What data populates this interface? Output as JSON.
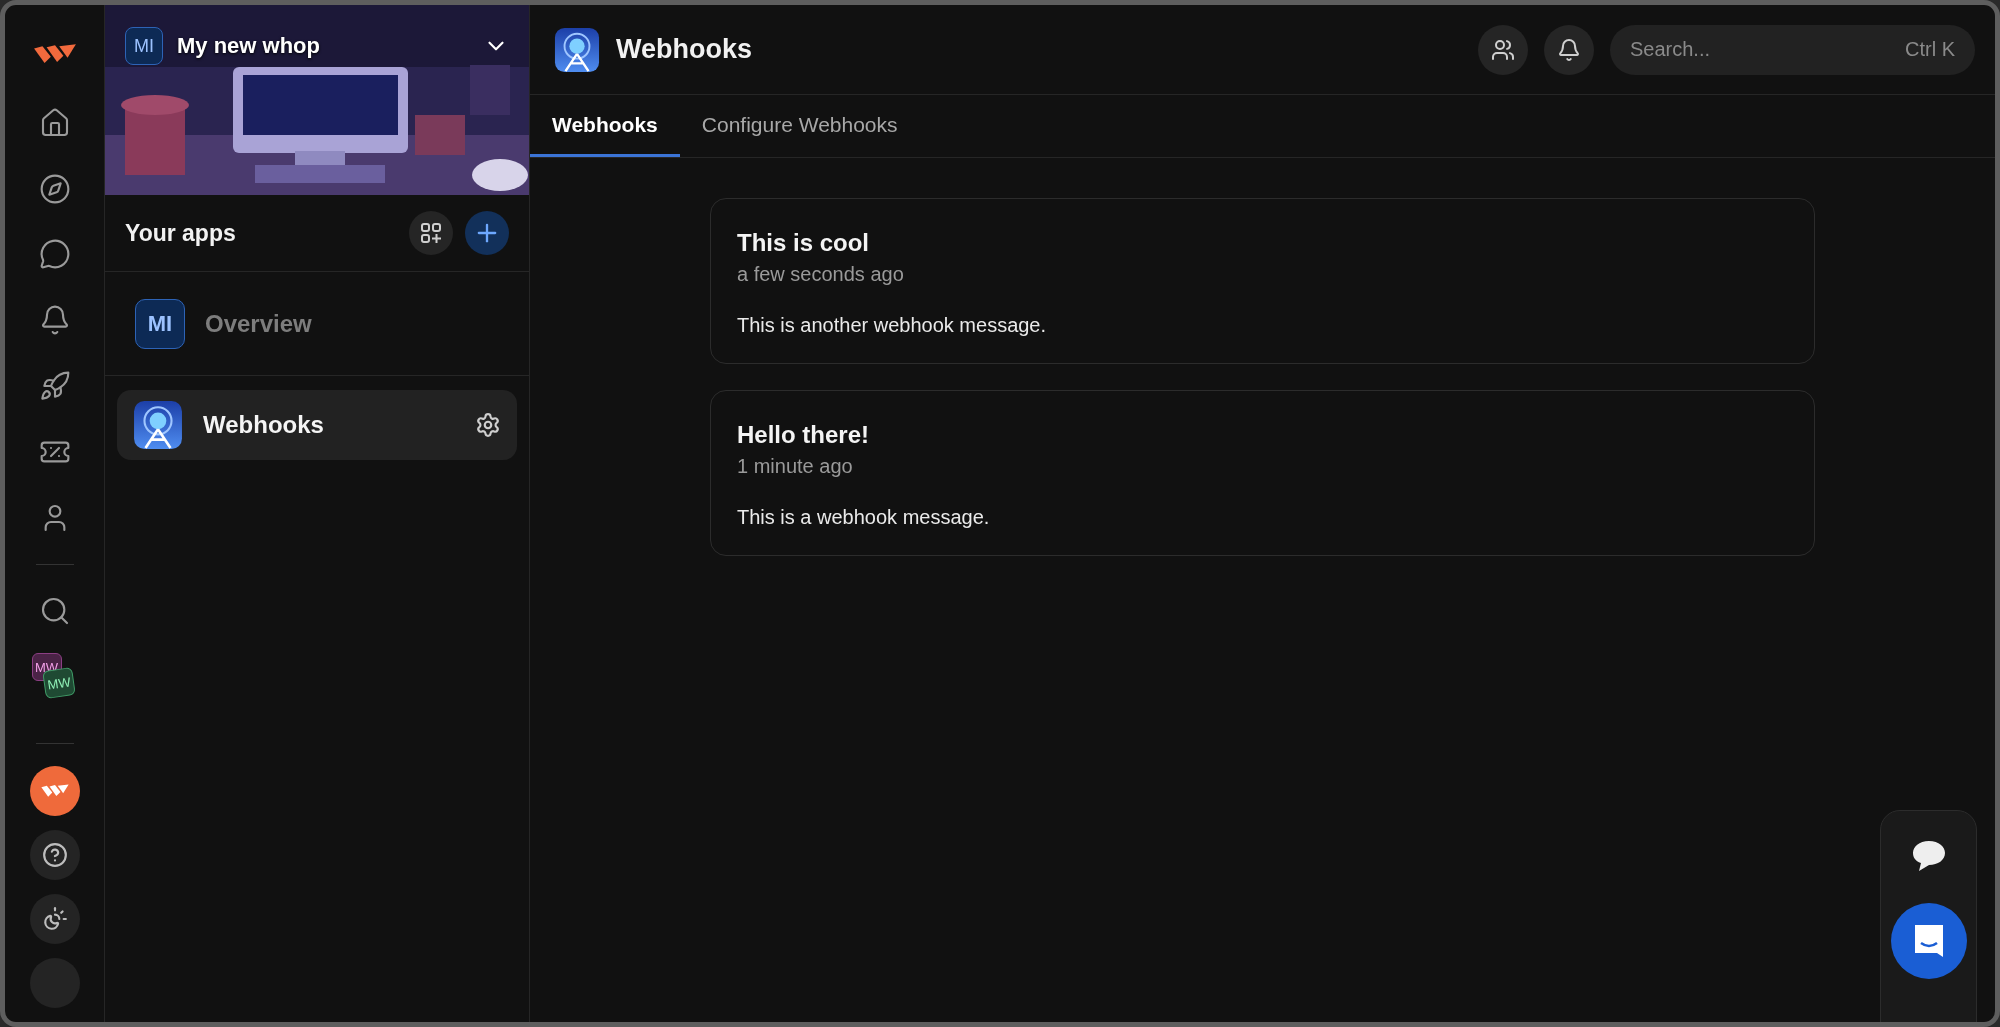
{
  "company": {
    "initials": "MI",
    "name": "My new whop"
  },
  "rail": {
    "switcher": [
      "MW",
      "MW"
    ]
  },
  "sidebar": {
    "title": "Your apps",
    "items": [
      {
        "kind": "overview",
        "initials": "MI",
        "label": "Overview",
        "selected": false
      },
      {
        "kind": "app",
        "label": "Webhooks",
        "selected": true
      }
    ]
  },
  "header": {
    "title": "Webhooks",
    "search": {
      "placeholder": "Search...",
      "shortcut": "Ctrl K"
    }
  },
  "tabs": [
    {
      "label": "Webhooks",
      "selected": true
    },
    {
      "label": "Configure Webhooks",
      "selected": false
    }
  ],
  "messages": [
    {
      "title": "This is cool",
      "time": "a few seconds ago",
      "body": "This is another webhook message."
    },
    {
      "title": "Hello there!",
      "time": "1 minute ago",
      "body": "This is a webhook message."
    }
  ]
}
